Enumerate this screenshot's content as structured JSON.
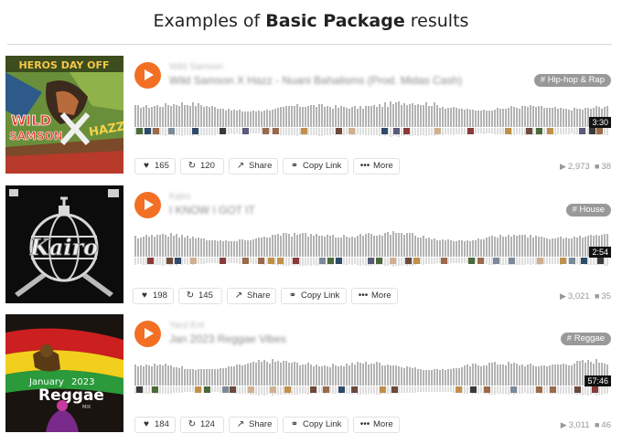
{
  "header": {
    "title_pre": "Examples of ",
    "title_bold": "Basic Package",
    "title_post": " results"
  },
  "colors": {
    "play": "#f26f23",
    "wave": "#b3b3b3",
    "tag": "#999999"
  },
  "action_labels": {
    "share": "Share",
    "copy_link": "Copy Link",
    "more": "More"
  },
  "tracks": [
    {
      "artist": "Wild Samson",
      "name": "Wild Samson X Hazz - Nuani Bahalisms (Prod. Midas Cash)",
      "tag": "# Hip-hop & Rap",
      "duration": "3:30",
      "likes": "165",
      "reposts": "120",
      "plays": "2,973",
      "comments": "38",
      "art": {
        "title": "HEROS DAY OFF",
        "line1": "WILD",
        "line2": "SAMSON"
      }
    },
    {
      "artist": "Kairo",
      "name": "I KNOW I GOT IT",
      "tag": "# House",
      "duration": "2:54",
      "likes": "198",
      "reposts": "145",
      "plays": "3,021",
      "comments": "35",
      "art": {
        "logo": "Kairo"
      }
    },
    {
      "artist": "Yard Ent",
      "name": "Jan 2023 Reggae Vibes",
      "tag": "# Reggae",
      "duration": "57:46",
      "likes": "184",
      "reposts": "124",
      "plays": "3,011",
      "comments": "46",
      "art": {
        "month": "January",
        "year": "2023",
        "genre": "Reggae",
        "mix": "MIX"
      }
    }
  ]
}
